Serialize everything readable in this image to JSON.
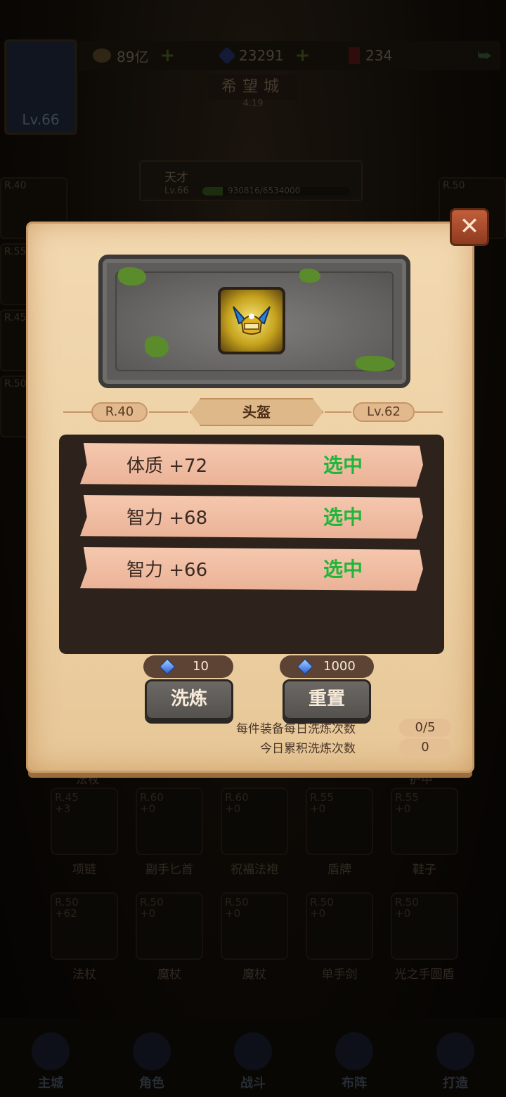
{
  "top_bar": {
    "gold": "89亿",
    "diamonds": "23291",
    "crystals": "234"
  },
  "player": {
    "level": "Lv.66",
    "title": "天才",
    "lv_small": "Lv.66",
    "exp": "930816/6534000",
    "exp_fraction": 0.14
  },
  "city": {
    "name": "希望城",
    "sub": "4.19"
  },
  "background_slots": {
    "left": [
      "R.40",
      "R.55",
      "R.45",
      "R.50"
    ],
    "right": [
      "R.50"
    ],
    "tabs": [
      "法杖",
      "护甲"
    ],
    "grid": [
      [
        {
          "rank": "R.45",
          "plus": "+3",
          "label": "项链"
        },
        {
          "rank": "R.60",
          "plus": "+0",
          "label": "副手匕首"
        },
        {
          "rank": "R.60",
          "plus": "+0",
          "label": "祝福法袍"
        },
        {
          "rank": "R.55",
          "plus": "+0",
          "label": "盾牌"
        },
        {
          "rank": "R.55",
          "plus": "+0",
          "label": "鞋子"
        }
      ],
      [
        {
          "rank": "R.50",
          "plus": "+62",
          "label": "法杖"
        },
        {
          "rank": "R.50",
          "plus": "+0",
          "label": "魔杖"
        },
        {
          "rank": "R.50",
          "plus": "+0",
          "label": "魔杖"
        },
        {
          "rank": "R.50",
          "plus": "+0",
          "label": "单手剑"
        },
        {
          "rank": "R.50",
          "plus": "+0",
          "label": "光之手圆盾"
        }
      ]
    ]
  },
  "nav": [
    "主城",
    "角色",
    "战斗",
    "布阵",
    "打造"
  ],
  "modal": {
    "rank": "R.40",
    "slot_name": "头盔",
    "level": "Lv.62",
    "attributes": [
      {
        "text": "体质 +72",
        "status": "选中"
      },
      {
        "text": "智力 +68",
        "status": "选中"
      },
      {
        "text": "智力 +66",
        "status": "选中"
      }
    ],
    "refine": {
      "cost": "10",
      "label": "洗炼"
    },
    "reset": {
      "cost": "1000",
      "label": "重置"
    },
    "daily_label": "每件装备每日洗炼次数",
    "daily_value": "0/5",
    "total_label": "今日累积洗炼次数",
    "total_value": "0",
    "close": "✕"
  },
  "colors": {
    "selected": "#1fb63a",
    "parchment": "#f0d5aa",
    "attr_row": "#f2c1a5",
    "attr_box": "#2d231c"
  }
}
